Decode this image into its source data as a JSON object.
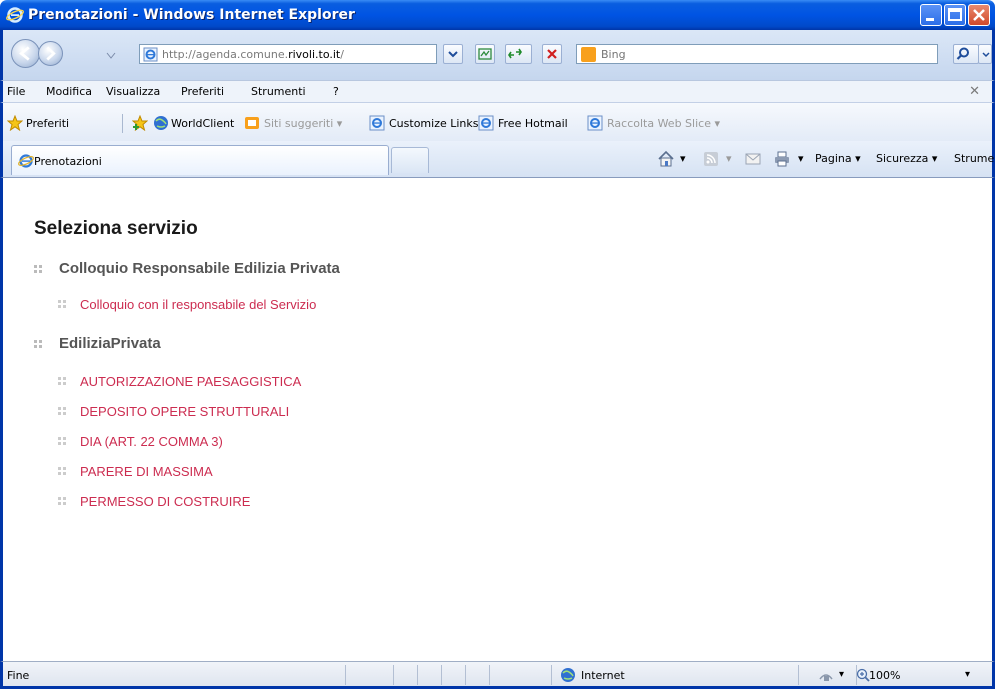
{
  "window": {
    "title": "Prenotazioni - Windows Internet Explorer"
  },
  "address_bar": {
    "url_prefix": "http://agenda.comune.",
    "url_domain": "rivoli.to.it",
    "url_suffix": "/"
  },
  "search": {
    "placeholder": "Bing"
  },
  "menu": {
    "items": [
      "File",
      "Modifica",
      "Visualizza",
      "Preferiti",
      "Strumenti",
      "?"
    ]
  },
  "favorites_bar": {
    "favorites_label": "Preferiti",
    "items": [
      "WorldClient",
      "Siti suggeriti ▾",
      "Customize Links",
      "Free Hotmail",
      "Raccolta Web Slice ▾"
    ]
  },
  "tab": {
    "label": "Prenotazioni"
  },
  "command_bar": {
    "pagina": "Pagina ▾",
    "sicurezza": "Sicurezza ▾",
    "strumenti": "Strumenti ▾"
  },
  "page": {
    "title": "Seleziona servizio",
    "groups": [
      {
        "name": "Colloquio Responsabile Edilizia Privata",
        "services": [
          "Colloquio con il responsabile del Servizio"
        ]
      },
      {
        "name": "EdiliziaPrivata",
        "services": [
          "AUTORIZZAZIONE PAESAGGISTICA",
          "DEPOSITO OPERE STRUTTURALI",
          "DIA (ART. 22 COMMA 3)",
          "PARERE DI MASSIMA",
          "PERMESSO DI COSTRUIRE"
        ]
      }
    ]
  },
  "status_bar": {
    "status": "Fine",
    "zone": "Internet",
    "zoom": "100%"
  },
  "colors": {
    "link": "#cc2c50",
    "group_title": "#555555",
    "title_bar": "#0054e3"
  }
}
